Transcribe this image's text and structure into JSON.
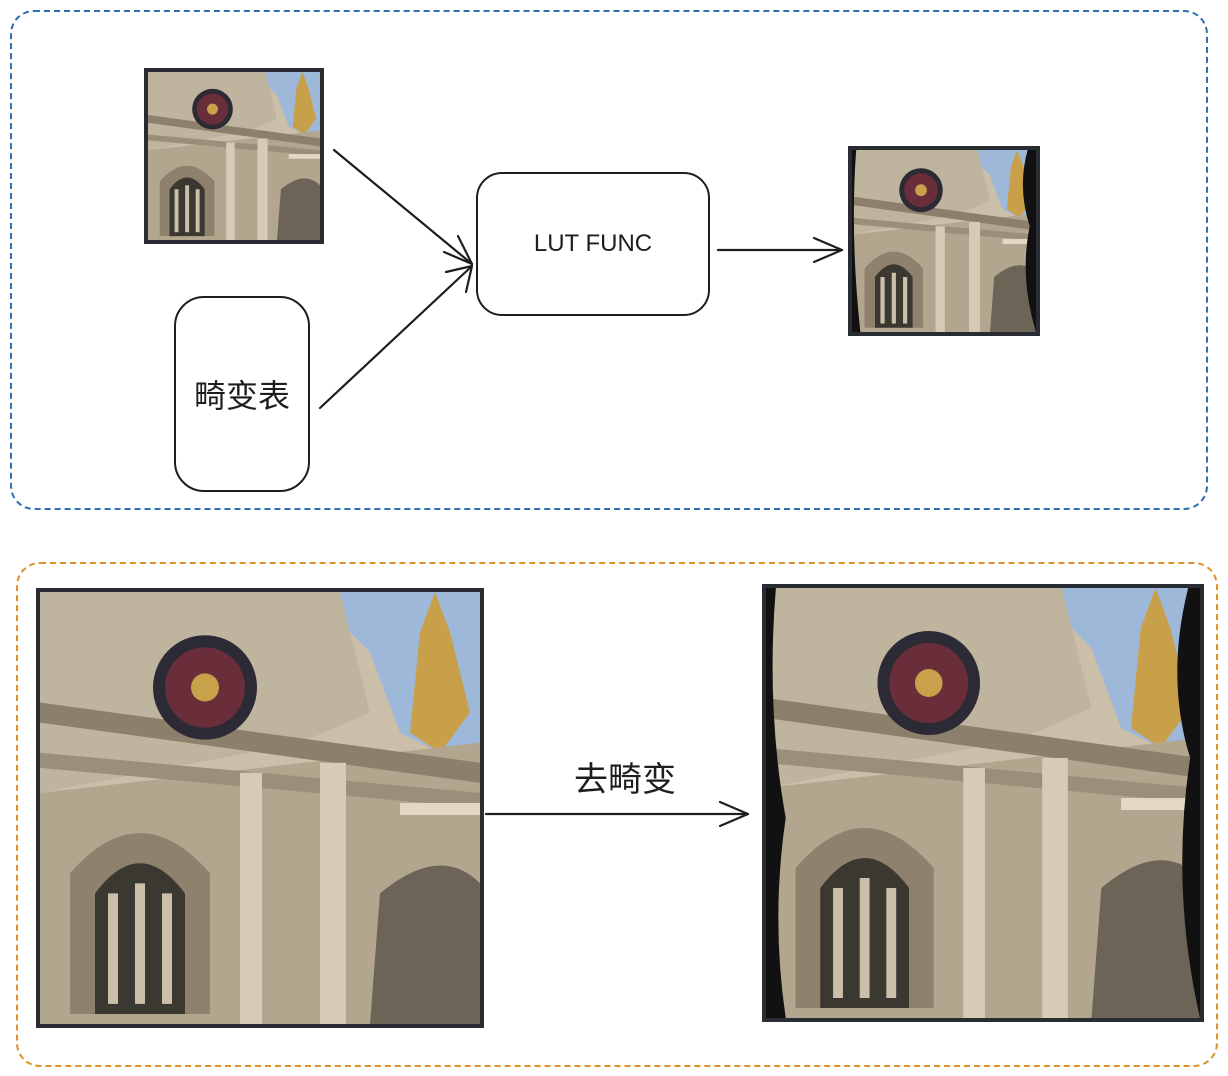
{
  "nodes": {
    "lut_func": "LUT FUNC",
    "distortion_table": "畸变表"
  },
  "edges": {
    "undistort_label": "去畸变"
  },
  "colors": {
    "group_blue": "#2f6fb5",
    "group_orange": "#e0922a",
    "stroke": "#1e1e1e",
    "photo_border": "#2a2c33"
  }
}
